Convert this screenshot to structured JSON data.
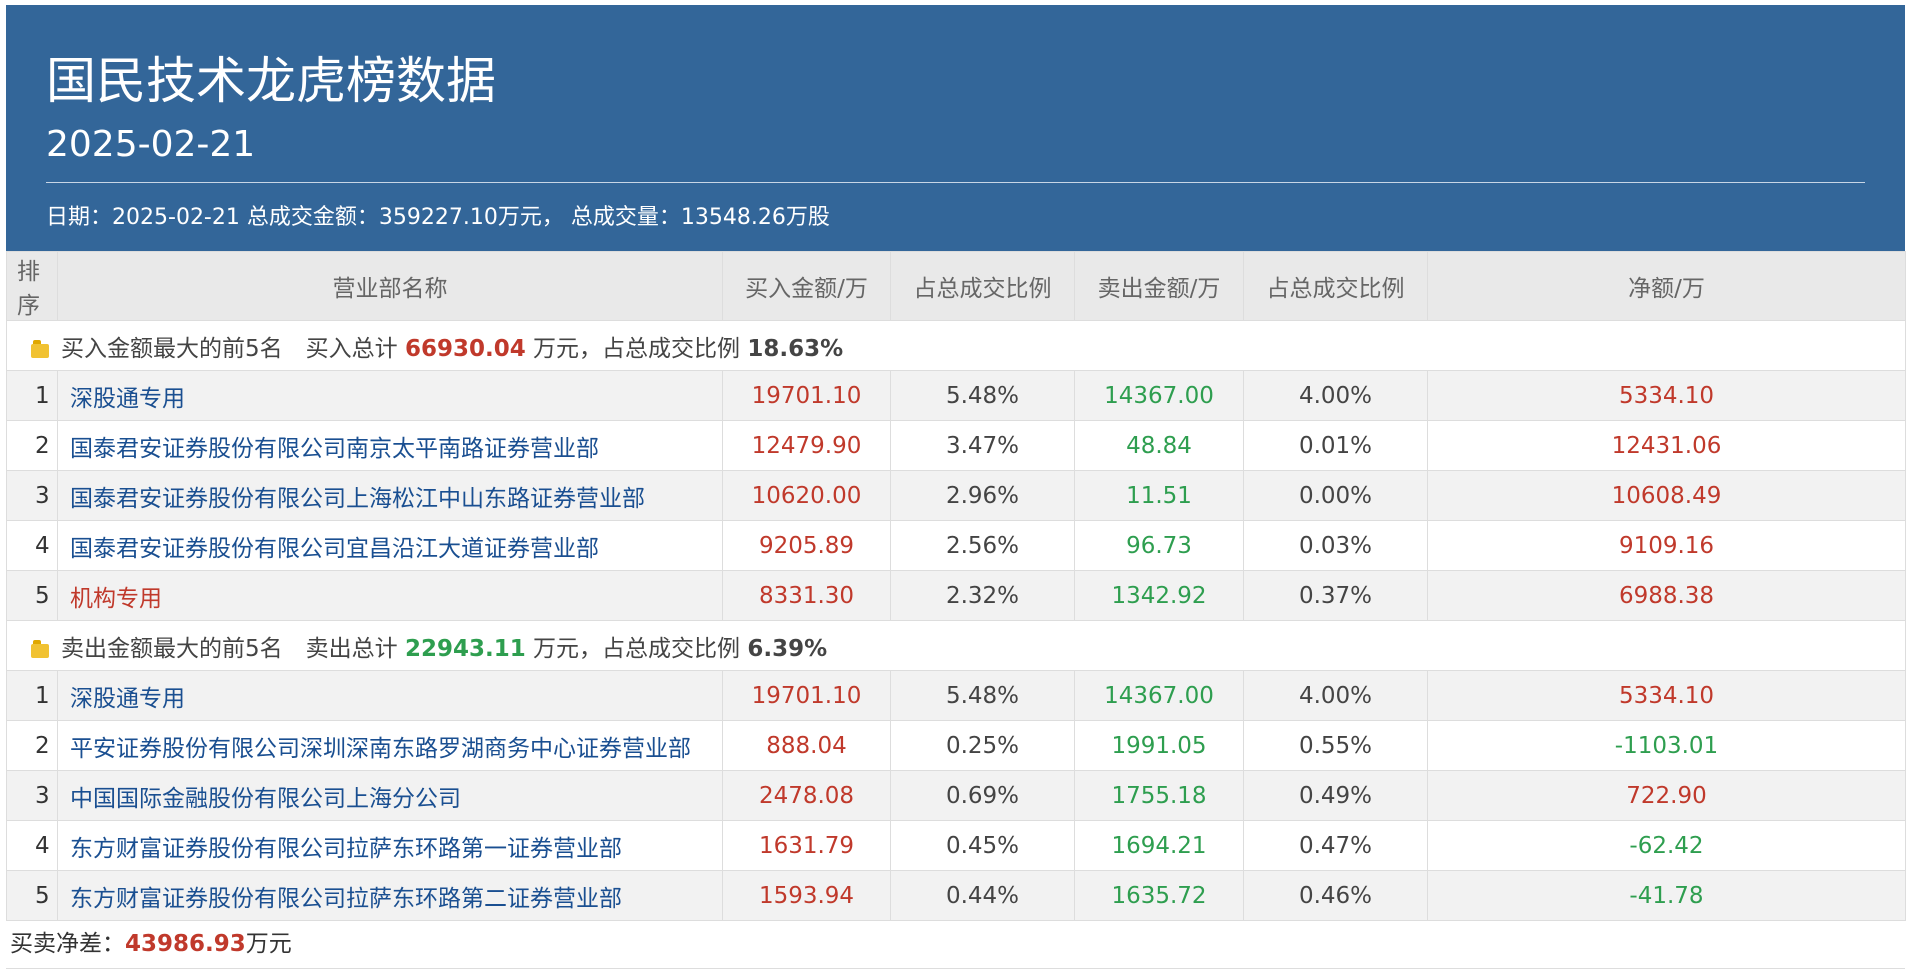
{
  "header": {
    "title": "国民技术龙虎榜数据",
    "date": "2025-02-21",
    "summary": {
      "date_label": "日期：",
      "date_value": "2025-02-21",
      "amount_label": " 总成交金额：",
      "amount_value": "359227.10万元，",
      "volume_label": " 总成交量：",
      "volume_value": "13548.26万股"
    }
  },
  "table": {
    "columns": [
      "排序",
      "营业部名称",
      "买入金额/万",
      "占总成交比例",
      "卖出金额/万",
      "占总成交比例",
      "净额/万"
    ],
    "buy_section": {
      "label": "买入金额最大的前5名",
      "total_label": "买入总计",
      "total_value": "66930.04",
      "unit_ratio_label": "万元，占总成交比例",
      "ratio_value": "18.63%",
      "rows": [
        {
          "rank": "1",
          "name": "深股通专用",
          "buy": "19701.10",
          "buy_ratio": "5.48%",
          "sell": "14367.00",
          "sell_ratio": "4.00%",
          "net": "5334.10"
        },
        {
          "rank": "2",
          "name": "国泰君安证券股份有限公司南京太平南路证券营业部",
          "buy": "12479.90",
          "buy_ratio": "3.47%",
          "sell": "48.84",
          "sell_ratio": "0.01%",
          "net": "12431.06"
        },
        {
          "rank": "3",
          "name": "国泰君安证券股份有限公司上海松江中山东路证券营业部",
          "buy": "10620.00",
          "buy_ratio": "2.96%",
          "sell": "11.51",
          "sell_ratio": "0.00%",
          "net": "10608.49"
        },
        {
          "rank": "4",
          "name": "国泰君安证券股份有限公司宜昌沿江大道证券营业部",
          "buy": "9205.89",
          "buy_ratio": "2.56%",
          "sell": "96.73",
          "sell_ratio": "0.03%",
          "net": "9109.16"
        },
        {
          "rank": "5",
          "name": "机构专用",
          "buy": "8331.30",
          "buy_ratio": "2.32%",
          "sell": "1342.92",
          "sell_ratio": "0.37%",
          "net": "6988.38"
        }
      ]
    },
    "sell_section": {
      "label": "卖出金额最大的前5名",
      "total_label": "卖出总计",
      "total_value": "22943.11",
      "unit_ratio_label": "万元，占总成交比例",
      "ratio_value": "6.39%",
      "rows": [
        {
          "rank": "1",
          "name": "深股通专用",
          "buy": "19701.10",
          "buy_ratio": "5.48%",
          "sell": "14367.00",
          "sell_ratio": "4.00%",
          "net": "5334.10"
        },
        {
          "rank": "2",
          "name": "平安证券股份有限公司深圳深南东路罗湖商务中心证券营业部",
          "buy": "888.04",
          "buy_ratio": "0.25%",
          "sell": "1991.05",
          "sell_ratio": "0.55%",
          "net": "-1103.01"
        },
        {
          "rank": "3",
          "name": "中国国际金融股份有限公司上海分公司",
          "buy": "2478.08",
          "buy_ratio": "0.69%",
          "sell": "1755.18",
          "sell_ratio": "0.49%",
          "net": "722.90"
        },
        {
          "rank": "4",
          "name": "东方财富证券股份有限公司拉萨东环路第一证券营业部",
          "buy": "1631.79",
          "buy_ratio": "0.45%",
          "sell": "1694.21",
          "sell_ratio": "0.47%",
          "net": "-62.42"
        },
        {
          "rank": "5",
          "name": "东方财富证券股份有限公司拉萨东环路第二证券营业部",
          "buy": "1593.94",
          "buy_ratio": "0.44%",
          "sell": "1635.72",
          "sell_ratio": "0.46%",
          "net": "-41.78"
        }
      ]
    }
  },
  "footer": {
    "label": "买卖净差：",
    "value": "43986.93",
    "unit": "万元"
  }
}
